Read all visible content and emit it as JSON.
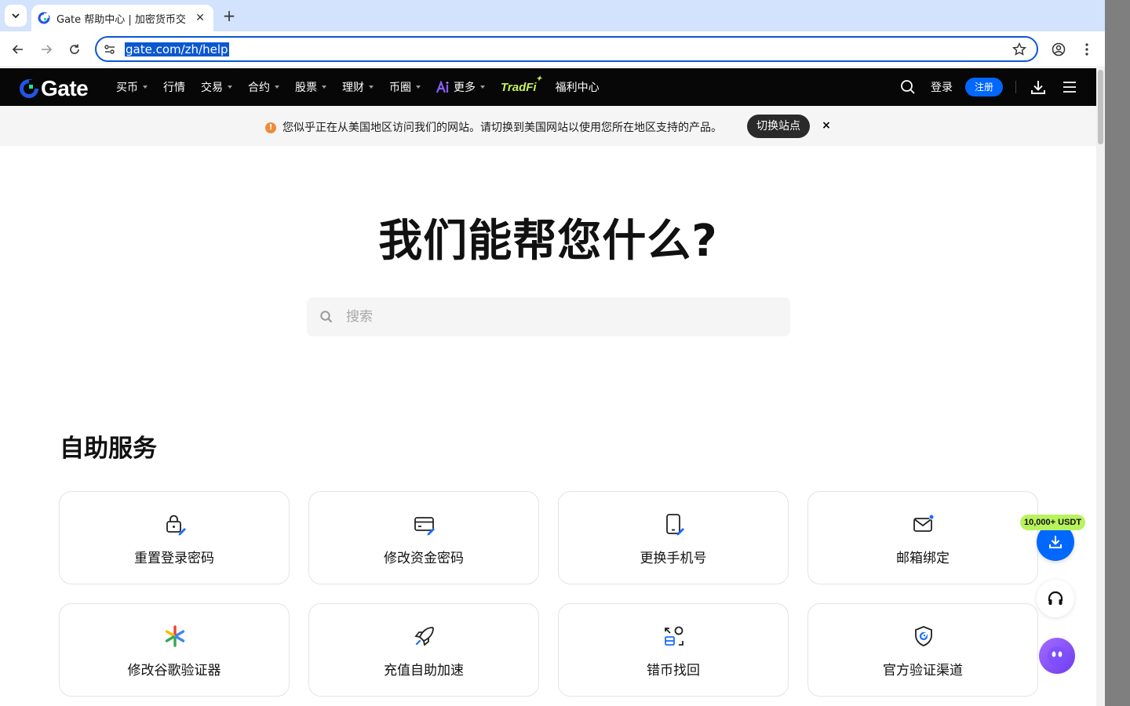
{
  "browser": {
    "tab_title": "Gate 帮助中心 | 加密货币交",
    "url": "gate.com/zh/help"
  },
  "header": {
    "logo_text": "Gate",
    "nav": [
      {
        "label": "买币",
        "dropdown": true
      },
      {
        "label": "行情",
        "dropdown": false
      },
      {
        "label": "交易",
        "dropdown": true
      },
      {
        "label": "合约",
        "dropdown": true
      },
      {
        "label": "股票",
        "dropdown": true
      },
      {
        "label": "理财",
        "dropdown": true
      },
      {
        "label": "币圈",
        "dropdown": true
      },
      {
        "label": "更多",
        "dropdown": true
      }
    ],
    "tradfi": "TradFi",
    "welfare": "福利中心",
    "login": "登录",
    "register": "注册"
  },
  "notice": {
    "text": "您似乎正在从美国地区访问我们的网站。请切换到美国网站以使用您所在地区支持的产品。",
    "switch_label": "切换站点",
    "close": "×"
  },
  "hero": {
    "title": "我们能帮您什么?",
    "search_placeholder": "搜索"
  },
  "self_service": {
    "title": "自助服务",
    "cards": [
      {
        "label": "重置登录密码",
        "icon": "lock-edit-icon"
      },
      {
        "label": "修改资金密码",
        "icon": "card-edit-icon"
      },
      {
        "label": "更换手机号",
        "icon": "phone-edit-icon"
      },
      {
        "label": "邮箱绑定",
        "icon": "mail-icon"
      },
      {
        "label": "修改谷歌验证器",
        "icon": "google-authenticator-icon"
      },
      {
        "label": "充值自助加速",
        "icon": "rocket-icon"
      },
      {
        "label": "错币找回",
        "icon": "coin-recovery-icon"
      },
      {
        "label": "官方验证渠道",
        "icon": "shield-icon"
      }
    ]
  },
  "floating": {
    "badge": "10,000+ USDT"
  },
  "colors": {
    "brand_blue": "#0068ff",
    "header_bg": "#070707",
    "tradfi_green": "#c6f25a",
    "badge_green": "#b8f25c",
    "notice_orange": "#f08a3c"
  }
}
